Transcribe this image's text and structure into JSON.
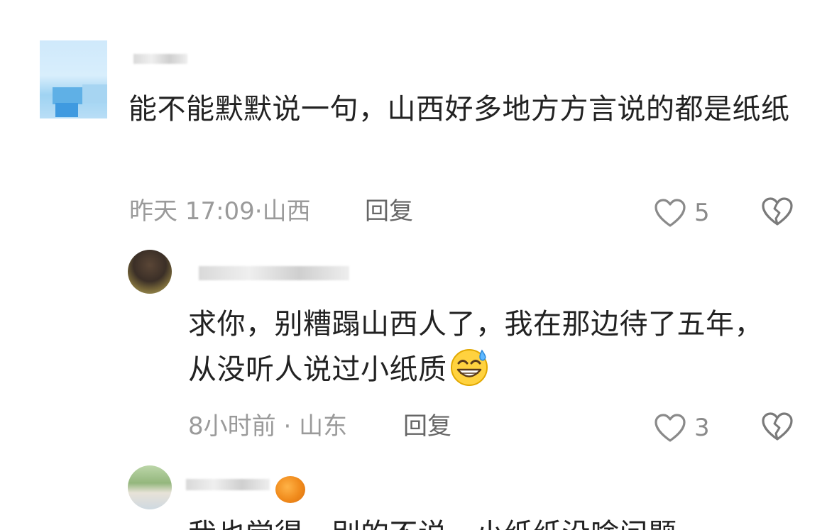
{
  "comments": [
    {
      "text": "能不能默默说一句，山西好多地方方言说的都是纸纸",
      "time": "昨天 17:09",
      "location": "山西",
      "reply_label": "回复",
      "likes": "5"
    },
    {
      "text": "求你，别糟蹋山西人了，我在那边待了五年，从没听人说过小纸质",
      "time": "8小时前",
      "location": "山东",
      "reply_label": "回复",
      "likes": "3"
    },
    {
      "text": "我也觉得，别的不说，小纸纸没啥问题"
    }
  ],
  "colors": {
    "text": "#222222",
    "meta": "#9a9a9a",
    "reply": "#666666",
    "icon": "#8a8a8a"
  },
  "icons": {
    "like": "heart-icon",
    "dislike": "broken-heart-icon",
    "emoji": "grinning-sweat-emoji"
  }
}
